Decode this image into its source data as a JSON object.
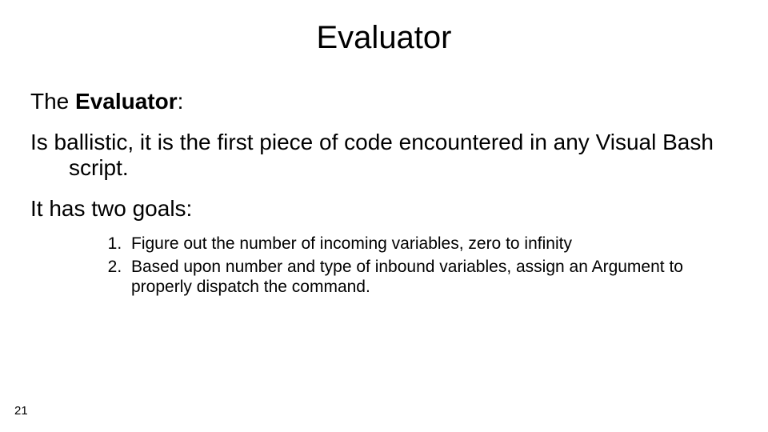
{
  "slide": {
    "title": "Evaluator",
    "intro_prefix": "The ",
    "intro_bold": "Evaluator",
    "intro_suffix": ":",
    "description": "Is ballistic, it is the first piece of code encountered in any Visual Bash script.",
    "goals_label": "It has two goals:",
    "steps": [
      "Figure out the number of incoming variables, zero to infinity",
      "Based upon number and type of inbound variables, assign an Argument to properly dispatch the command."
    ],
    "page_number": "21"
  }
}
